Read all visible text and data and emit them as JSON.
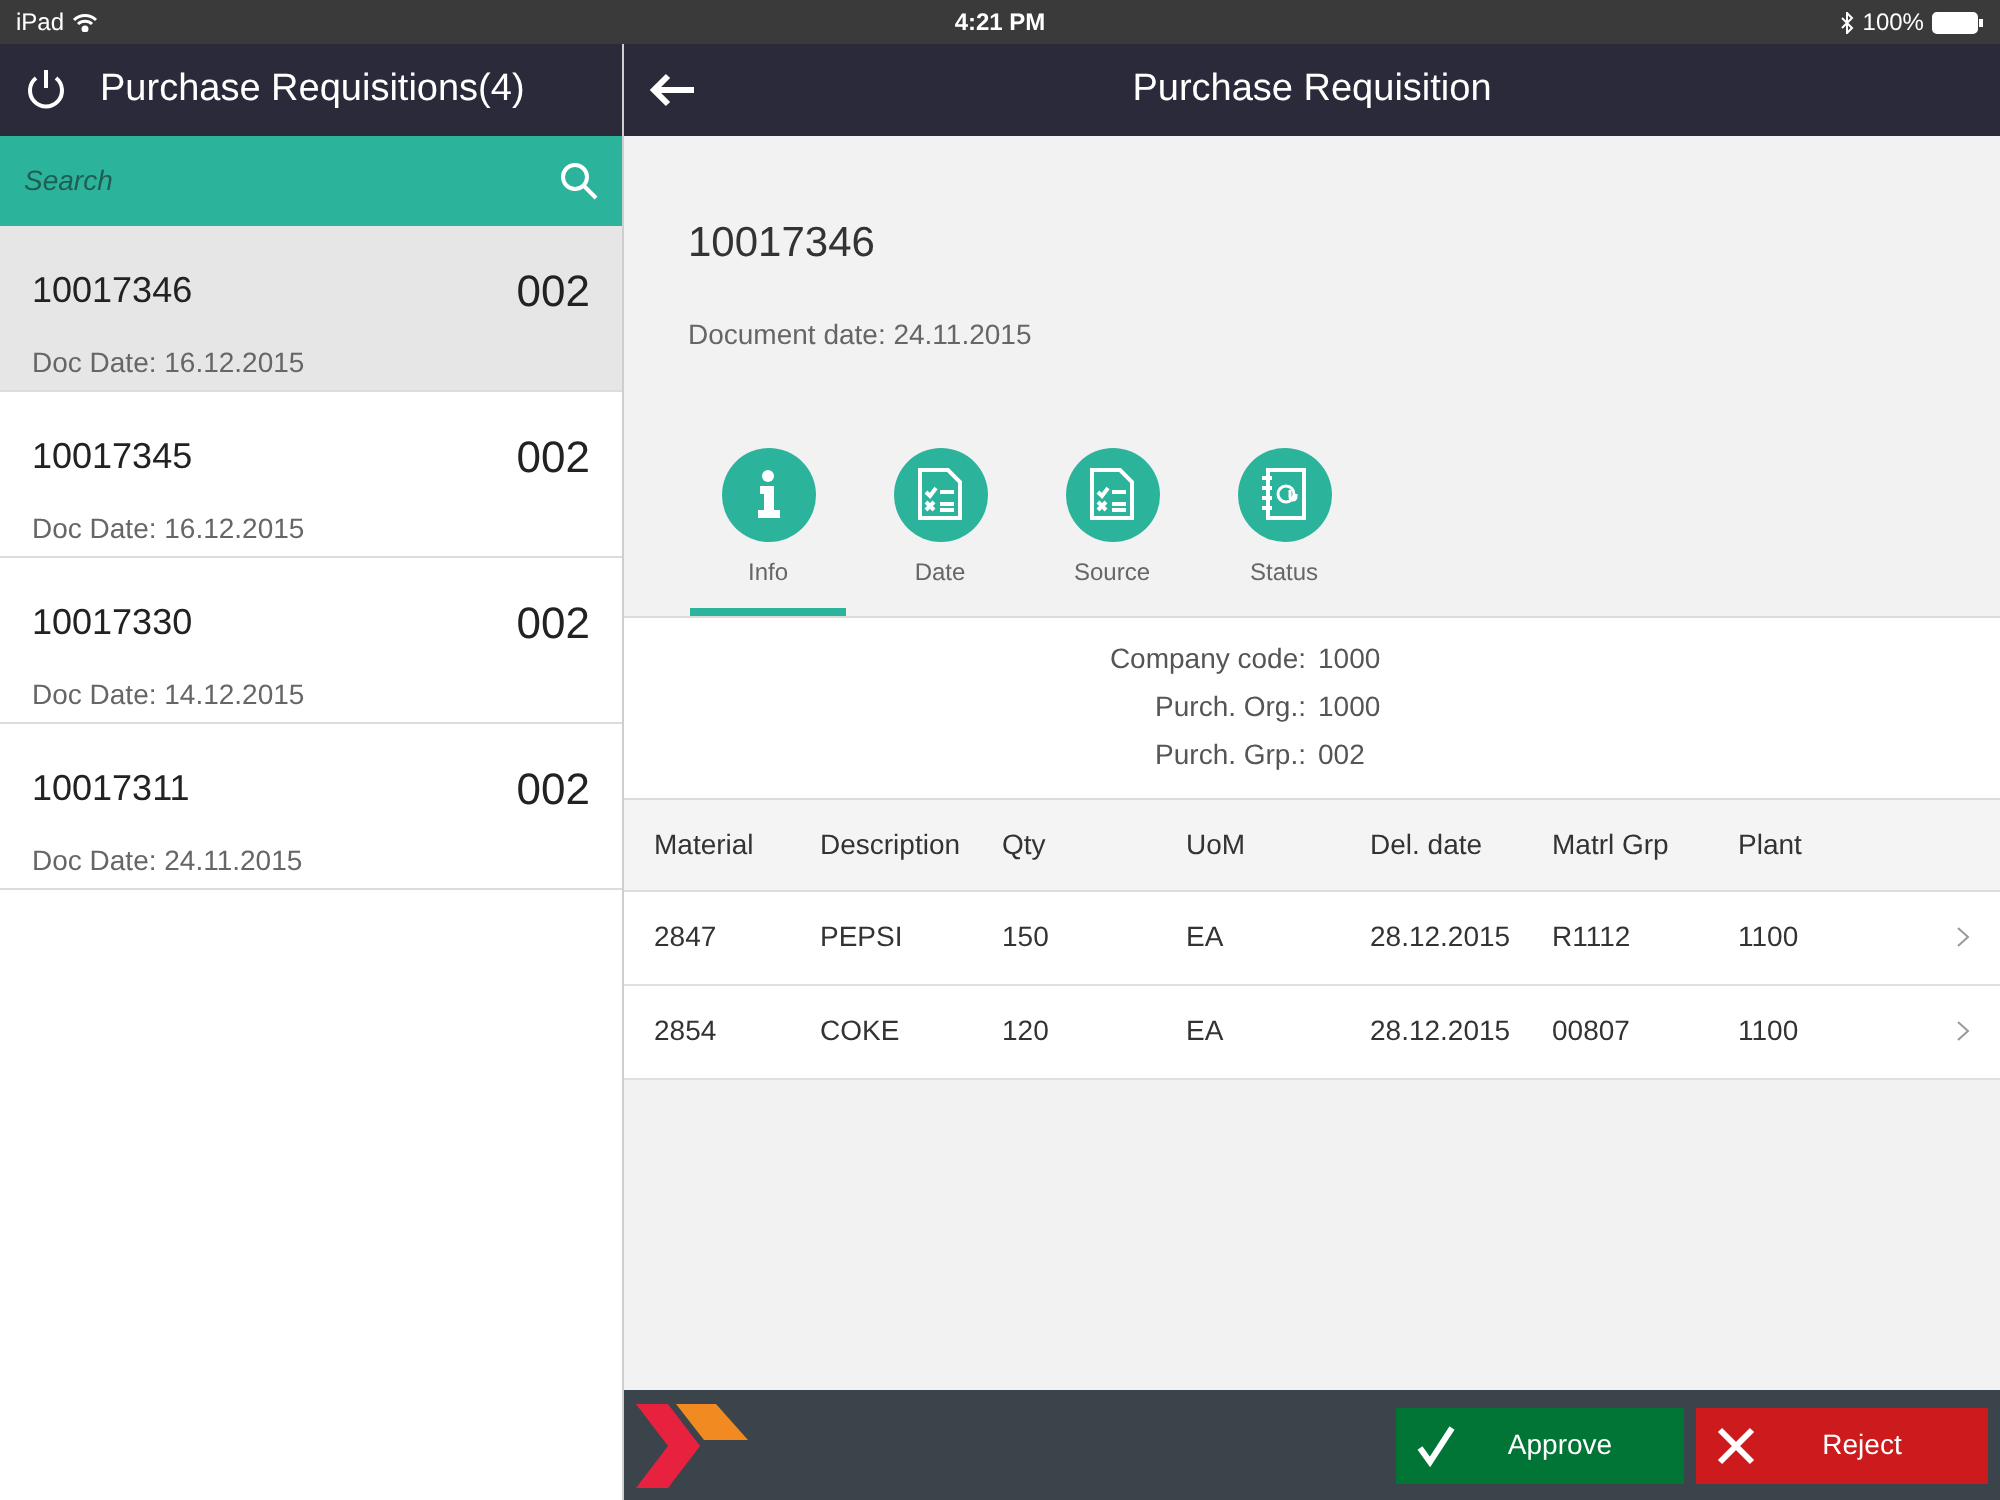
{
  "status_bar": {
    "device": "iPad",
    "time": "4:21 PM",
    "battery": "100%"
  },
  "sidebar": {
    "title": "Purchase Requisitions(4)",
    "search": {
      "placeholder": "Search"
    },
    "items": [
      {
        "number": "10017346",
        "code": "002",
        "doc_date": "Doc Date: 16.12.2015",
        "selected": true
      },
      {
        "number": "10017345",
        "code": "002",
        "doc_date": "Doc Date: 16.12.2015",
        "selected": false
      },
      {
        "number": "10017330",
        "code": "002",
        "doc_date": "Doc Date: 14.12.2015",
        "selected": false
      },
      {
        "number": "10017311",
        "code": "002",
        "doc_date": "Doc Date: 24.11.2015",
        "selected": false
      }
    ]
  },
  "detail": {
    "title": "Purchase Requisition",
    "number": "10017346",
    "document_date": "Document date: 24.11.2015",
    "tabs": [
      {
        "label": "Info",
        "kind": "info",
        "selected": true
      },
      {
        "label": "Date",
        "kind": "checklist",
        "selected": false
      },
      {
        "label": "Source",
        "kind": "checklist",
        "selected": false
      },
      {
        "label": "Status",
        "kind": "notebook",
        "selected": false
      }
    ],
    "info": [
      {
        "label": "Company code:",
        "value": "1000"
      },
      {
        "label": "Purch. Org.:",
        "value": "1000"
      },
      {
        "label": "Purch. Grp.:",
        "value": "002"
      }
    ],
    "table": {
      "columns": [
        "Material",
        "Description",
        "Qty",
        "UoM",
        "Del. date",
        "Matrl Grp",
        "Plant"
      ],
      "rows": [
        [
          "2847",
          "PEPSI",
          "150",
          "EA",
          "28.12.2015",
          "R1112",
          "1100"
        ],
        [
          "2854",
          "COKE",
          "120",
          "EA",
          "28.12.2015",
          "00807",
          "1100"
        ]
      ]
    }
  },
  "actions": {
    "approve": "Approve",
    "reject": "Reject"
  }
}
